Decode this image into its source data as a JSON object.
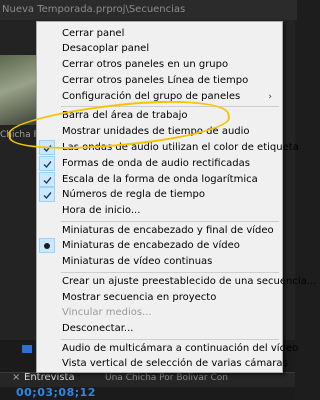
{
  "window": {
    "title": "Nueva Temporada.prproj\\Secuencias"
  },
  "background": {
    "thumb_caption": "Chicha Po",
    "tab_title": "Entrevista",
    "sequence_name": "Una Chicha Por Bolivar Con",
    "timecode": "00;03;08;12"
  },
  "menu": {
    "items": [
      {
        "label": "Cerrar panel",
        "type": "normal"
      },
      {
        "label": "Desacoplar panel",
        "type": "normal"
      },
      {
        "label": "Cerrar otros paneles en un grupo",
        "type": "normal"
      },
      {
        "label": "Cerrar otros paneles Línea de tiempo",
        "type": "normal"
      },
      {
        "label": "Configuración del grupo de paneles",
        "type": "submenu"
      },
      {
        "label": "Barra del área de trabajo",
        "type": "normal"
      },
      {
        "label": "Mostrar unidades de tiempo de audio",
        "type": "normal"
      },
      {
        "label": "Las ondas de audio utilizan el color de etiqueta",
        "type": "checked"
      },
      {
        "label": "Formas de onda de audio rectificadas",
        "type": "checked"
      },
      {
        "label": "Escala de la forma de onda logarítmica",
        "type": "checked"
      },
      {
        "label": "Números de regla de tiempo",
        "type": "checked"
      },
      {
        "label": "Hora de inicio...",
        "type": "normal"
      },
      {
        "label": "Miniaturas de encabezado y final de vídeo",
        "type": "normal"
      },
      {
        "label": "Miniaturas de encabezado de vídeo",
        "type": "radio"
      },
      {
        "label": "Miniaturas de vídeo continuas",
        "type": "normal"
      },
      {
        "label": "Crear un ajuste preestablecido de una secuencia...",
        "type": "normal"
      },
      {
        "label": "Mostrar secuencia en proyecto",
        "type": "normal"
      },
      {
        "label": "Vincular medios...",
        "type": "disabled"
      },
      {
        "label": "Desconectar...",
        "type": "normal"
      },
      {
        "label": "Audio de multicámara a continuación del vídeo",
        "type": "normal"
      },
      {
        "label": "Vista vertical de selección de varias cámaras",
        "type": "normal"
      }
    ],
    "submenu_arrow": "›",
    "check_icon": "checkmark-icon",
    "radio_icon": "radio-dot-icon"
  },
  "colors": {
    "menu_bg": "#f0f0f0",
    "check_bg": "#cce8ff",
    "highlight": "#f5c400",
    "timecode": "#2f86e5"
  }
}
